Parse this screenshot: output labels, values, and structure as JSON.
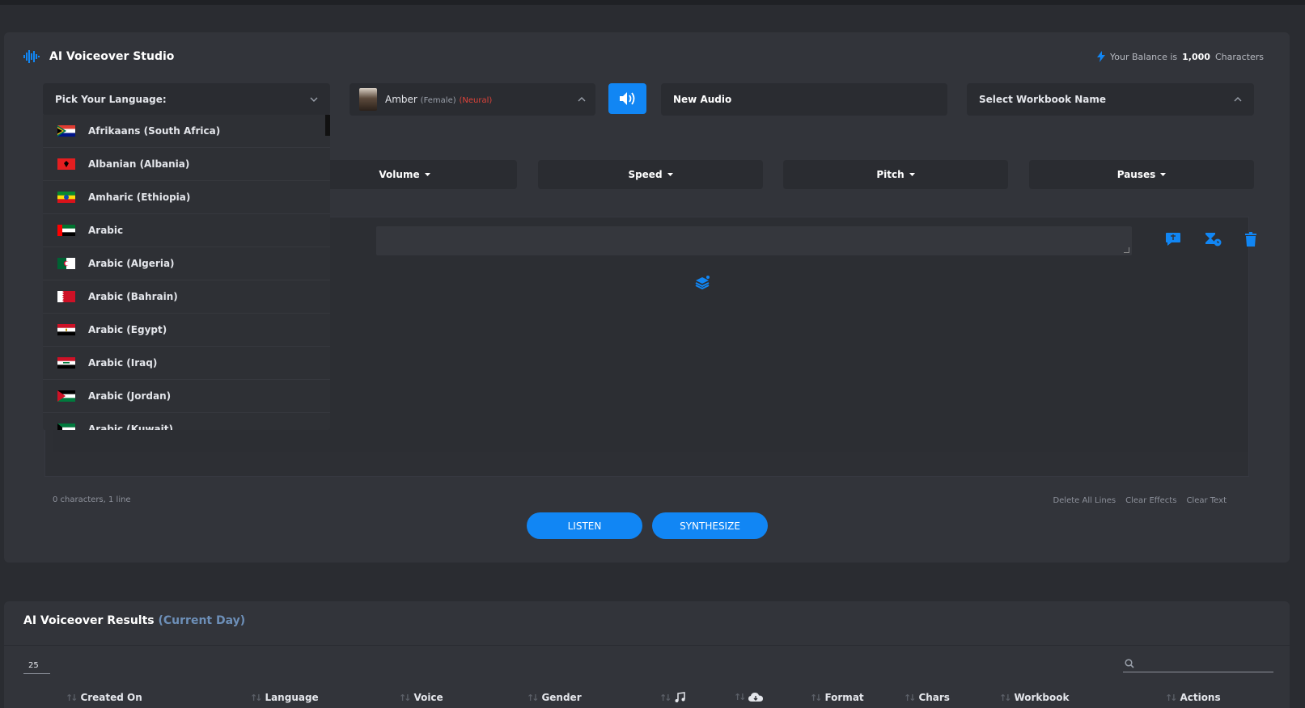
{
  "studio": {
    "title": "AI Voiceover Studio",
    "balance_prefix": "Your Balance is",
    "balance_value": "1,000",
    "balance_suffix": "Characters"
  },
  "language_select": {
    "label": "Pick Your Language:"
  },
  "voice_select": {
    "name": "Amber",
    "gender": "(Female)",
    "engine": "(Neural)"
  },
  "audio_name": {
    "value": "New Audio"
  },
  "workbook_select": {
    "label": "Select Workbook Name"
  },
  "effects": {
    "volume": "Volume",
    "speed": "Speed",
    "pitch": "Pitch",
    "pauses": "Pauses"
  },
  "editor": {
    "counter": "0 characters, 1 line",
    "delete_all": "Delete All Lines",
    "clear_effects": "Clear Effects",
    "clear_text": "Clear Text"
  },
  "actions": {
    "listen": "LISTEN",
    "synthesize": "SYNTHESIZE"
  },
  "languages": [
    {
      "label": "Afrikaans (South Africa)",
      "flag": "za"
    },
    {
      "label": "Albanian (Albania)",
      "flag": "al"
    },
    {
      "label": "Amharic (Ethiopia)",
      "flag": "et"
    },
    {
      "label": "Arabic",
      "flag": "ae"
    },
    {
      "label": "Arabic (Algeria)",
      "flag": "dz"
    },
    {
      "label": "Arabic (Bahrain)",
      "flag": "bh"
    },
    {
      "label": "Arabic (Egypt)",
      "flag": "eg"
    },
    {
      "label": "Arabic (Iraq)",
      "flag": "iq"
    },
    {
      "label": "Arabic (Jordan)",
      "flag": "jo"
    },
    {
      "label": "Arabic (Kuwait)",
      "flag": "kw"
    }
  ],
  "results": {
    "title": "AI Voiceover Results",
    "subtitle": "(Current Day)",
    "page_size": "25",
    "columns": {
      "created_on": "Created On",
      "language": "Language",
      "voice": "Voice",
      "gender": "Gender",
      "format": "Format",
      "chars": "Chars",
      "workbook": "Workbook",
      "actions": "Actions"
    }
  },
  "colors": {
    "accent": "#1186f4",
    "neural": "#e0433a",
    "subtitle": "#6d8fb8"
  }
}
